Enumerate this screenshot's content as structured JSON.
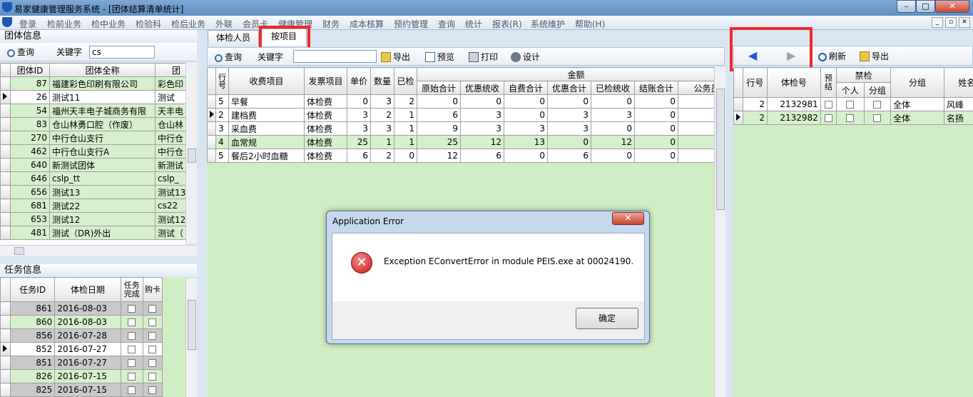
{
  "window": {
    "title": "易家健康管理服务系统 - [团体结算清单统计]",
    "min": "–",
    "max": "□",
    "close": "✕"
  },
  "menu": [
    "登录",
    "检前业务",
    "检中业务",
    "检验科",
    "检后业务",
    "外联",
    "会员卡",
    "健康管理",
    "财务",
    "成本核算",
    "预约管理",
    "查询",
    "统计",
    "报表(R)",
    "系统维护",
    "帮助(H)"
  ],
  "group_panel": {
    "title": "团体信息",
    "query_label": "查询",
    "keyword_label": "关键字",
    "keyword_value": "cs",
    "columns": [
      "团体ID",
      "团体全称",
      "团"
    ],
    "rows": [
      {
        "id": "87",
        "name": "福建彩色印刷有限公司",
        "short": "彩色印"
      },
      {
        "id": "26",
        "name": "测试11",
        "short": "测试"
      },
      {
        "id": "54",
        "name": "福州天丰电子城商务有限",
        "short": "天丰电"
      },
      {
        "id": "83",
        "name": "仓山林勇口腔（作废）",
        "short": "仓山林"
      },
      {
        "id": "270",
        "name": "中行仓山支行",
        "short": "中行仓"
      },
      {
        "id": "462",
        "name": "中行仓山支行A",
        "short": "中行仓"
      },
      {
        "id": "640",
        "name": "新测试团体",
        "short": "新测试"
      },
      {
        "id": "646",
        "name": "cslp_tt",
        "short": "cslp_"
      },
      {
        "id": "656",
        "name": "测试13",
        "short": "测试13"
      },
      {
        "id": "681",
        "name": "测试22",
        "short": "cs22"
      },
      {
        "id": "653",
        "name": "测试12",
        "short": "测试12"
      },
      {
        "id": "481",
        "name": "测试（DR)外出",
        "short": "测试（"
      }
    ]
  },
  "task_panel": {
    "title": "任务信息",
    "columns": [
      "任务ID",
      "体检日期",
      "任务完成",
      "购卡"
    ],
    "rows": [
      {
        "id": "861",
        "date": "2016-08-03"
      },
      {
        "id": "860",
        "date": "2016-08-03"
      },
      {
        "id": "856",
        "date": "2016-07-28"
      },
      {
        "id": "852",
        "date": "2016-07-27"
      },
      {
        "id": "851",
        "date": "2016-07-27"
      },
      {
        "id": "826",
        "date": "2016-07-15"
      },
      {
        "id": "825",
        "date": "2016-07-15"
      }
    ]
  },
  "tabs": [
    "体检人员",
    "按项目"
  ],
  "center_toolbar": {
    "query": "查询",
    "keyword": "关键字",
    "export": "导出",
    "preview": "预览",
    "print": "打印",
    "design": "设计"
  },
  "items_table": {
    "group_header": "金额",
    "columns": [
      "行号",
      "收费项目",
      "发票项目",
      "单价",
      "数量",
      "已检",
      "原始合计",
      "优惠统收",
      "自费合计",
      "优惠合计",
      "已检统收",
      "结账合计",
      "公务员"
    ],
    "rows": [
      {
        "no": "5",
        "item": "早餐",
        "inv": "体检费",
        "price": "0",
        "qty": "3",
        "done": "2",
        "orig": "0",
        "disc": "0",
        "self": "0",
        "disc_total": "0",
        "done_collect": "0",
        "settle": "0"
      },
      {
        "no": "2",
        "item": "建档费",
        "inv": "体检费",
        "price": "3",
        "qty": "2",
        "done": "1",
        "orig": "6",
        "disc": "3",
        "self": "0",
        "disc_total": "3",
        "done_collect": "3",
        "settle": "0"
      },
      {
        "no": "3",
        "item": "采血费",
        "inv": "体检费",
        "price": "3",
        "qty": "3",
        "done": "1",
        "orig": "9",
        "disc": "3",
        "self": "3",
        "disc_total": "3",
        "done_collect": "0",
        "settle": "0"
      },
      {
        "no": "4",
        "item": "血常规",
        "inv": "体检费",
        "price": "25",
        "qty": "1",
        "done": "1",
        "orig": "25",
        "disc": "12",
        "self": "13",
        "disc_total": "0",
        "done_collect": "12",
        "settle": "0"
      },
      {
        "no": "5",
        "item": "餐后2小时血糖",
        "inv": "体检费",
        "price": "6",
        "qty": "2",
        "done": "0",
        "orig": "12",
        "disc": "6",
        "self": "0",
        "disc_total": "6",
        "done_collect": "0",
        "settle": "0"
      }
    ]
  },
  "right_toolbar": {
    "refresh": "刷新",
    "export": "导出"
  },
  "people_table": {
    "columns": [
      "行号",
      "体检号",
      "预结",
      "禁检",
      "个人",
      "分组",
      "分组",
      "姓名"
    ],
    "rows": [
      {
        "no": "2",
        "exam": "2132981",
        "group": "全体",
        "name": "风峰"
      },
      {
        "no": "2",
        "exam": "2132982",
        "group": "全体",
        "name": "名扬"
      }
    ]
  },
  "dialog": {
    "title": "Application Error",
    "message": "Exception EConvertError in module PEIS.exe at 00024190.",
    "ok": "确定",
    "icon": "✕",
    "close": "✕"
  },
  "colors": {
    "highlight_box": "#f02a2a",
    "grid_green": "#cfeec4"
  }
}
